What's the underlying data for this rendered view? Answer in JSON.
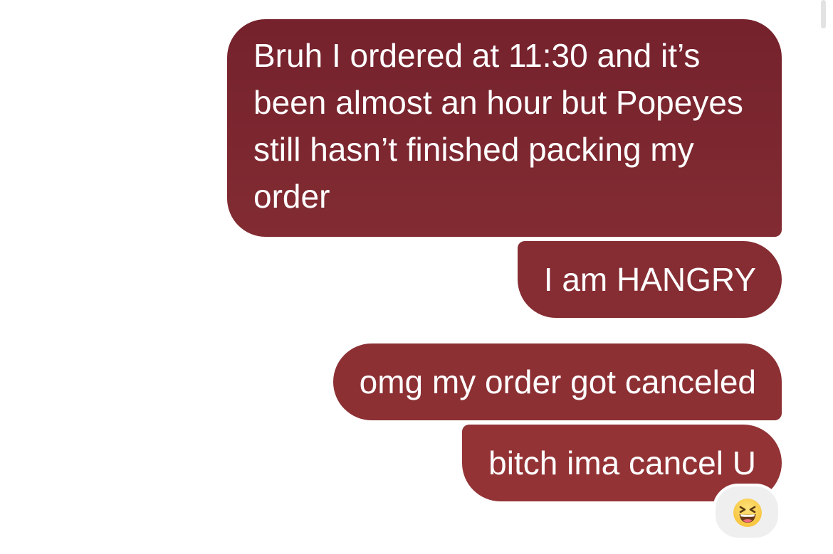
{
  "conversation": {
    "messages": [
      {
        "text": "Bruh I ordered at 11:30 and it’s been almost an hour but Popeyes still hasn’t finished packing my order",
        "sender": "me"
      },
      {
        "text": "I am HANGRY",
        "sender": "me"
      },
      {
        "text": "omg my order got canceled",
        "sender": "me"
      },
      {
        "text": "bitch ima cancel U",
        "sender": "me"
      }
    ],
    "reaction": {
      "icon": "grinning-squinting-face-icon",
      "on_message_index": 3
    }
  },
  "colors": {
    "bubble_top": "#75222d",
    "bubble_bottom": "#933335",
    "background": "#ffffff",
    "reaction_background": "#efefef"
  }
}
